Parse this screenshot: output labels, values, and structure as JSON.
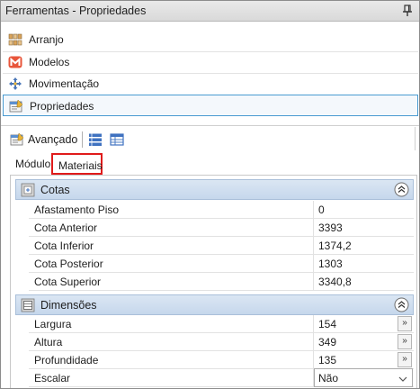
{
  "window": {
    "title": "Ferramentas - Propriedades",
    "pin_icon": "pin-icon"
  },
  "nav": {
    "items": [
      {
        "label": "Arranjo",
        "icon": "arranjo-icon"
      },
      {
        "label": "Modelos",
        "icon": "modelos-icon"
      },
      {
        "label": "Movimentação",
        "icon": "movimentacao-icon"
      },
      {
        "label": "Propriedades",
        "icon": "propriedades-icon",
        "selected": true
      }
    ]
  },
  "toolbar": {
    "advanced_label": "Avançado",
    "icons": [
      "avancado-icon",
      "list-view-icon",
      "table-view-icon"
    ]
  },
  "tabs": [
    {
      "label": "Módulo"
    },
    {
      "label": "Materiais",
      "highlighted": true
    }
  ],
  "groups": {
    "cotas": {
      "label": "Cotas",
      "rows": [
        {
          "name": "Afastamento Piso",
          "value": "0"
        },
        {
          "name": "Cota Anterior",
          "value": "3393"
        },
        {
          "name": "Cota Inferior",
          "value": "1374,2"
        },
        {
          "name": "Cota Posterior",
          "value": "1303"
        },
        {
          "name": "Cota Superior",
          "value": "3340,8"
        }
      ]
    },
    "dimensoes": {
      "label": "Dimensões",
      "rows": [
        {
          "name": "Largura",
          "value": "154",
          "button": "»"
        },
        {
          "name": "Altura",
          "value": "349",
          "button": "»"
        },
        {
          "name": "Profundidade",
          "value": "135",
          "button": "»"
        },
        {
          "name": "Escalar",
          "value": "Não"
        }
      ]
    }
  },
  "colors": {
    "selection_border": "#4a9bd1",
    "tab_highlight": "#e01b1b",
    "group_header": "#c6d7ec"
  }
}
